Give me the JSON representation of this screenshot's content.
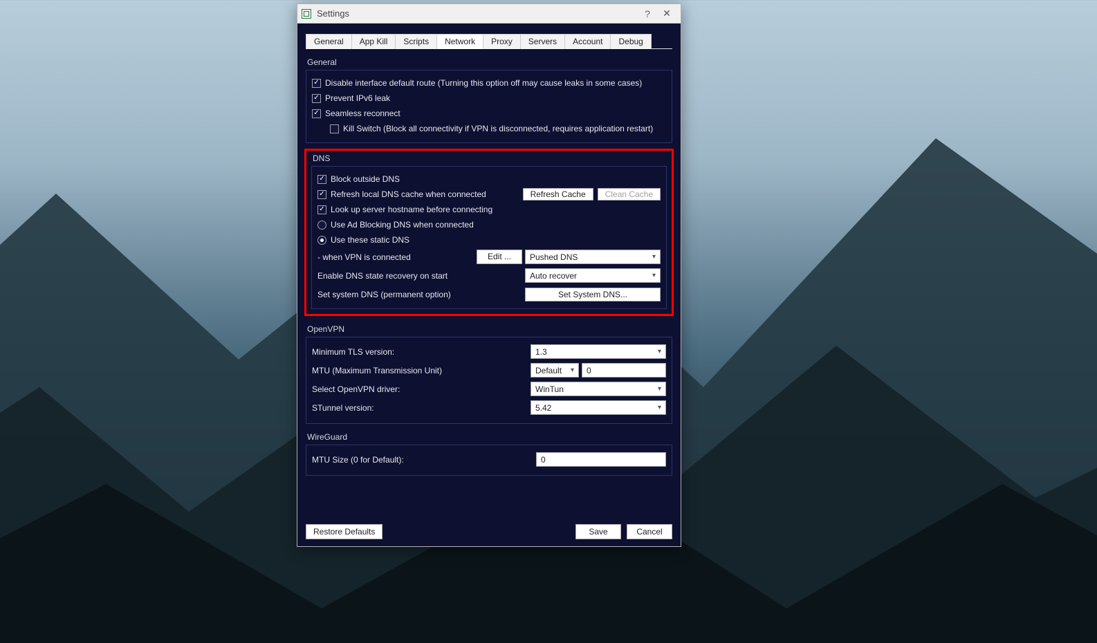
{
  "window": {
    "title": "Settings",
    "help_glyph": "?",
    "close_glyph": "✕"
  },
  "tabs": [
    "General",
    "App Kill",
    "Scripts",
    "Network",
    "Proxy",
    "Servers",
    "Account",
    "Debug"
  ],
  "active_tab": "Network",
  "sections": {
    "general": {
      "title": "General",
      "opt_disable_route": "Disable interface default route (Turning this option off may cause leaks in some cases)",
      "opt_prevent_ipv6": "Prevent IPv6 leak",
      "opt_seamless": "Seamless reconnect",
      "opt_killswitch": "Kill Switch (Block all connectivity if VPN is disconnected, requires application restart)"
    },
    "dns": {
      "title": "DNS",
      "opt_block_outside": "Block outside DNS",
      "opt_refresh_cache": "Refresh local DNS cache when connected",
      "btn_refresh": "Refresh Cache",
      "btn_clean": "Clean Cache",
      "opt_lookup": "Look up server hostname before connecting",
      "opt_adblock": "Use Ad Blocking DNS when connected",
      "opt_static": "Use these static DNS",
      "row_when_connected": "- when VPN is connected",
      "btn_edit": "Edit ...",
      "sel_pushed": "Pushed DNS",
      "row_recovery": "Enable DNS state recovery on start",
      "sel_recovery": "Auto recover",
      "row_set_system": "Set system DNS (permanent option)",
      "btn_set_system": "Set System DNS..."
    },
    "openvpn": {
      "title": "OpenVPN",
      "row_tls": "Minimum TLS version:",
      "sel_tls": "1.3",
      "row_mtu": "MTU (Maximum Transmission Unit)",
      "sel_mtu_mode": "Default",
      "val_mtu": "0",
      "row_driver": "Select OpenVPN driver:",
      "sel_driver": "WinTun",
      "row_stunnel": "STunnel version:",
      "sel_stunnel": "5.42"
    },
    "wireguard": {
      "title": "WireGuard",
      "row_mtu": "MTU Size (0 for Default):",
      "val_mtu": "0"
    }
  },
  "footer": {
    "restore": "Restore Defaults",
    "save": "Save",
    "cancel": "Cancel"
  }
}
